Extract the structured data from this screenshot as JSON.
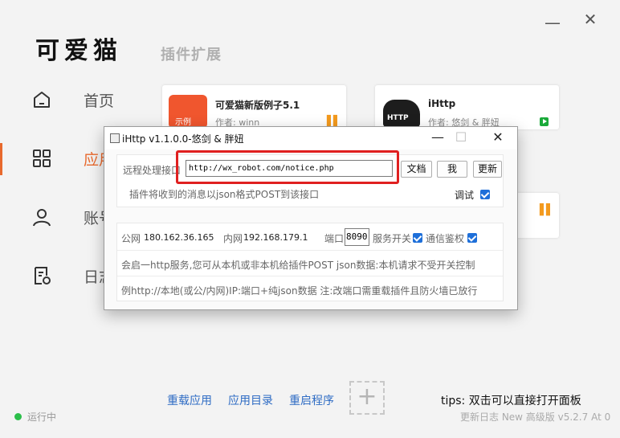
{
  "app": {
    "logo_text": "可爱猫",
    "section_title": "插件扩展"
  },
  "window_controls": {
    "minimize": "—",
    "close": "✕"
  },
  "sidebar": {
    "items": [
      {
        "label": "首页",
        "icon": "home-icon"
      },
      {
        "label": "应用",
        "icon": "apps-grid-icon",
        "active": true
      },
      {
        "label": "账号",
        "icon": "user-icon"
      },
      {
        "label": "日志",
        "icon": "log-settings-icon"
      }
    ]
  },
  "cards": [
    {
      "name": "可爱猫新版例子5.1",
      "author": "作者: winn",
      "icon_text": "示例",
      "icon": "example-app-icon",
      "status": "paused",
      "accent": "#e8692d"
    },
    {
      "name": "iHttp",
      "author": "作者: 悠剑 & 胖妞",
      "icon_text": "HTTP",
      "icon": "http-cloud-icon",
      "status": "running",
      "accent": "#1aaa3a"
    }
  ],
  "dialog": {
    "title": "iHttp v1.1.0.0-悠剑 & 胖妞",
    "remote_label": "远程处理接口",
    "remote_url": "http://wx_robot.com/notice.php",
    "doc_button": "文档",
    "me_button": "我",
    "update_button": "更新",
    "hint": "插件将收到的消息以json格式POST到该接口",
    "debug_label": "调试",
    "public_ip_label": "公网",
    "public_ip": "180.162.36.165",
    "lan_ip_label": "内网",
    "lan_ip": "192.168.179.1",
    "port_label": "端口",
    "port": "8090",
    "service_switch_label": "服务开关",
    "auth_label": "通信鉴权",
    "info1": "会启一http服务,您可从本机或非本机给插件POST json数据:本机请求不受开关控制",
    "info2": "例http://本地(或公/内网)IP:端口+纯json数据 注:改端口需重载插件且防火墙已放行"
  },
  "bottom": {
    "links": [
      "重载应用",
      "应用目录",
      "重启程序"
    ],
    "plus": "+",
    "tips": "tips: 双击可以直接打开面板",
    "status": "运行中",
    "version": "更新日志 New 高级版 v5.2.7 At 0"
  }
}
